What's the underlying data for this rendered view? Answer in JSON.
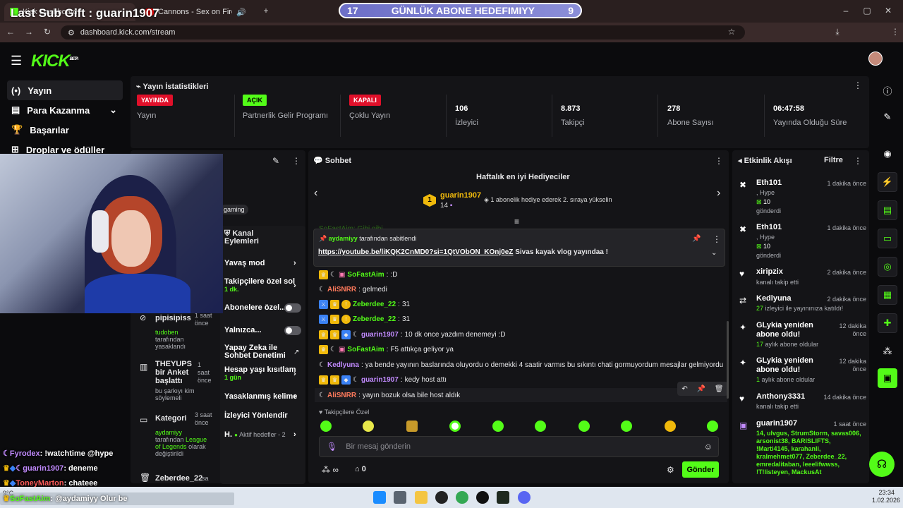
{
  "browser": {
    "tabs": [
      {
        "title": "Kick Dashboard"
      },
      {
        "title": "Cannons - Sex on Fire (Kings o"
      }
    ],
    "url": "dashboard.kick.com/stream"
  },
  "overlay": {
    "sub_gift": "Last Sub Gift : guarin1907",
    "goal_left": "17",
    "goal_title": "GÜNLÜK ABONE HEDEFIMIYY",
    "goal_right": "9"
  },
  "kick": {
    "logo": "KICK",
    "logo_sup": "BETA"
  },
  "sidebar": {
    "items": [
      {
        "icon": "broadcast-icon",
        "label": "Yayın"
      },
      {
        "icon": "money-icon",
        "label": "Para Kazanma"
      },
      {
        "icon": "trophy-icon",
        "label": "Başarılar"
      },
      {
        "icon": "gift-icon",
        "label": "Droplar ve ödüller"
      }
    ]
  },
  "stats": {
    "title": "Yayın İstatistikleri",
    "cells": [
      {
        "badge": "YAYINDA",
        "badge_color": "#e0102a",
        "label": "Yayın"
      },
      {
        "badge": "AÇIK",
        "badge_color": "#53fc18",
        "label": "Partnerlik Gelir Programı"
      },
      {
        "badge": "KAPALI",
        "badge_color": "#e0102a",
        "label": "Çoklu Yayın"
      },
      {
        "value": "106",
        "label": "İzleyici"
      },
      {
        "value": "8.873",
        "label": "Takipçi"
      },
      {
        "value": "278",
        "label": "Abone Sayısı"
      },
      {
        "value": "06:47:58",
        "label": "Yayında Olduğu Süre"
      }
    ]
  },
  "stream_info": {
    "tag": "gaming"
  },
  "channel_actions": {
    "title": "Kanal Eylemleri",
    "items": [
      {
        "label": "Yavaş mod"
      },
      {
        "label": "Takipçilere özel sol",
        "sub": "1 dk."
      },
      {
        "label": "Abonelere özel..."
      },
      {
        "label": "Yalnızca..."
      },
      {
        "label": "Yapay Zeka ile Sohbet Denetimi"
      },
      {
        "label": "Hesap yaşı kısıtlam",
        "sub": "1 gün"
      },
      {
        "label": "Yasaklanmış kelime"
      },
      {
        "label": "İzleyici Yönlendir"
      },
      {
        "label": "H.",
        "sub": "Aktif hedefler - 2"
      }
    ]
  },
  "modlog": [
    {
      "title": "pipisipiss",
      "time": "1 saat önce"
    },
    {
      "title": "",
      "sub_green": "tudoben",
      "sub": "tarafından yasaklandı"
    },
    {
      "title": "THEYUPS bir Anket başlattı",
      "time": "1 saat önce",
      "sub": "bu şarkıyı kim söylemeli"
    },
    {
      "title": "Kategori",
      "time": "3 saat önce",
      "sub_green": "aydamiyy",
      "sub": "tarafından",
      "sub_green2": "League of Legends",
      "sub2": "olarak değiştirildi"
    },
    {
      "title": "Zeberdee_22",
      "time": "sa"
    }
  ],
  "chat": {
    "title": "Sohbet",
    "gifters_title": "Haftalık en iyi Hediyeciler",
    "gifter_name": "guarin1907",
    "gifter_rank": "1",
    "gifter_count": "14",
    "gifter_hint": "1 abonelik hediye ederek 2. sıraya yükselin",
    "pinned_by_user": "aydamiyy",
    "pinned_by_text": "tarafından sabitlendi",
    "pinned_link": "https://youtube.be/liKQK2CnMD0?si=1QtVObON_KOnj0eZ",
    "pinned_text": "Sivas kayak vlog yayındaa !",
    "hidden_msg": "SoFastAim: Gibi gibi",
    "messages": [
      {
        "user": "SoFastAim",
        "color": "#53fc18",
        "text": ":D"
      },
      {
        "user": "AliSNRR",
        "color": "#ff7a5c",
        "text": "gelmedi"
      },
      {
        "user": "Zeberdee_22",
        "color": "#53fc18",
        "text": "31"
      },
      {
        "user": "Zeberdee_22",
        "color": "#53fc18",
        "text": "31"
      },
      {
        "user": "guarin1907",
        "color": "#c28bff",
        "text": "10 dk once yazdım denemeyi :D"
      },
      {
        "user": "SoFastAim",
        "color": "#53fc18",
        "text": "F5 attıkça geliyor ya"
      },
      {
        "user": "Kedlyuna",
        "color": "#c28bff",
        "text": "ya bende yayının baslarında oluyordu o demekki 4 saatir varmıs bu sıkıntı chati gormuyordum mesajlar gelmiyordu"
      },
      {
        "user": "guarin1907",
        "color": "#c28bff",
        "text": "kedy host attı"
      },
      {
        "user": "AliSNRR",
        "color": "#ff7a5c",
        "text": "yayın bozuk olsa bile host aldık"
      }
    ],
    "emote_section": "Takipçilere Özel",
    "input_placeholder": "Bir mesaj gönderin",
    "points": "0",
    "send_label": "Gönder"
  },
  "events": {
    "title": "Etkinlik Akışı",
    "filter": "Filtre",
    "items": [
      {
        "icon": "kick-icon",
        "name": "Eth101",
        "time": "1 dakika önce",
        "l1": ", Hype",
        "l2": "10",
        "l3": "gönderdi"
      },
      {
        "icon": "kick-icon",
        "name": "Eth101",
        "time": "1 dakika önce",
        "l1": ", Hype",
        "l2": "10",
        "l3": "gönderdi"
      },
      {
        "icon": "heart-icon",
        "name": "xiripzix",
        "time": "2 dakika önce",
        "l1": "kanalı takip etti"
      },
      {
        "icon": "host-icon",
        "name": "Kedlyuna",
        "time": "2 dakika önce",
        "l1g": "27",
        "l1": "izleyici ile yayınınıza katıldı!"
      },
      {
        "icon": "sparkle-icon",
        "name": "GLykia yeniden abone oldu!",
        "time": "12 dakika önce",
        "l1g": "17",
        "l1": "aylık abone oldular"
      },
      {
        "icon": "sparkle-icon",
        "name": "GLykia yeniden abone oldu!",
        "time": "12 dakika önce",
        "l1g": "1",
        "l1": "aylık abone oldular"
      },
      {
        "icon": "heart-icon",
        "name": "Anthony3331",
        "time": "14 dakika önce",
        "l1": "kanalı takip etti"
      },
      {
        "icon": "gift-icon",
        "name": "guarin1907",
        "time": "1 saat önce",
        "list": "14, ulvgus, StrumStorm, savas006, arsonist38, BARISLIFTS, !Marti4145, karahanli, kralmehmet077, Zeberdee_22, emredalitaban, leeelifwwss, !T!listeyen, MackusAt"
      }
    ]
  },
  "overlay_chat": [
    {
      "user": "Fyrodex",
      "color": "#c28bff",
      "text": "!watchtime @hype"
    },
    {
      "user": "guarin1907",
      "color": "#c28bff",
      "text": "deneme"
    },
    {
      "user": "ToneyMarton",
      "color": "#ff5a5a",
      "text": "chateee"
    },
    {
      "user": "SoFastAim",
      "color": "#53fc18",
      "text": "@aydamiyy Olur be"
    }
  ],
  "taskbar": {
    "weather": "9°C",
    "time": "23:34",
    "date": "1.02.2026"
  }
}
